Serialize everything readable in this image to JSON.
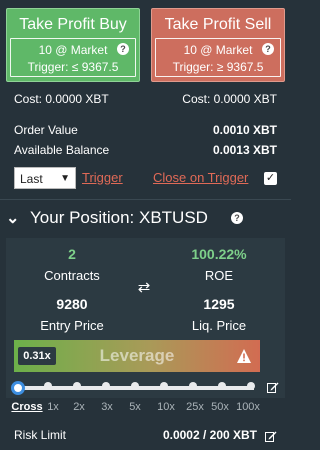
{
  "buy_button": {
    "title": "Take Profit Buy",
    "line1": "10 @ Market",
    "line2": "Trigger: ≤ 9367.5",
    "help": "?"
  },
  "sell_button": {
    "title": "Take Profit Sell",
    "line1": "10 @ Market",
    "line2": "Trigger: ≥ 9367.5",
    "help": "?"
  },
  "cost": {
    "buy": "Cost: 0.0000 XBT",
    "sell": "Cost: 0.0000 XBT"
  },
  "order_value": {
    "label": "Order Value",
    "value": "0.0010 XBT"
  },
  "available_balance": {
    "label": "Available Balance",
    "value": "0.0013 XBT"
  },
  "trigger_controls": {
    "select_value": "Last",
    "trigger_link": "Trigger",
    "close_on_trigger": "Close on Trigger",
    "close_on_trigger_checked": true
  },
  "position": {
    "title": "Your Position: XBTUSD",
    "help": "?",
    "contracts_value": "2",
    "contracts_label": "Contracts",
    "roe_value": "100.22%",
    "roe_label": "ROE",
    "entry_price_value": "9280",
    "entry_price_label": "Entry Price",
    "liq_price_value": "1295",
    "liq_price_label": "Liq. Price"
  },
  "leverage": {
    "current": "0.31x",
    "label": "Leverage",
    "ticks": [
      "Cross",
      "1x",
      "2x",
      "3x",
      "5x",
      "10x",
      "25x",
      "50x",
      "100x"
    ],
    "selected_tick": "Cross"
  },
  "risk_limit": {
    "label": "Risk Limit",
    "value": "0.0002 / 200 XBT"
  },
  "colors": {
    "background": "#26323a",
    "buy": "#5fb868",
    "sell": "#cd6e5e",
    "link": "#e06a57",
    "positive": "#7ed08a",
    "slider_handle": "#3d8ee0"
  }
}
